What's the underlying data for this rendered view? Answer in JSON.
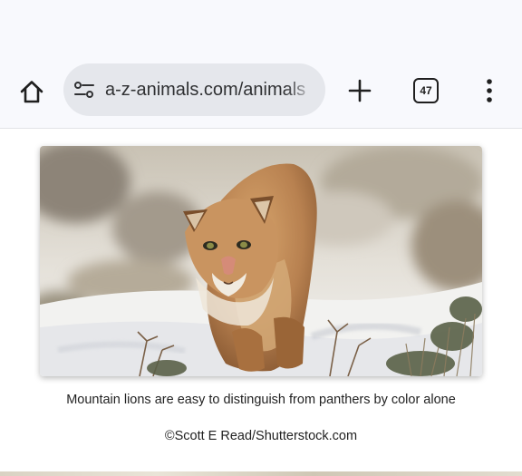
{
  "browser": {
    "url": "a-z-animals.com/animals",
    "tab_count": "47",
    "icons": {
      "home": "home-icon",
      "site_settings": "tune-icon",
      "new_tab": "plus-icon",
      "menu": "more-vertical-icon"
    },
    "colors": {
      "toolbar_bg": "#f8f9fd",
      "omnibox_bg": "#e5e7ec"
    }
  },
  "article": {
    "image_caption": "Mountain lions are easy to distinguish from panthers by color alone",
    "image_credit": "©Scott E Read/Shutterstock.com"
  }
}
